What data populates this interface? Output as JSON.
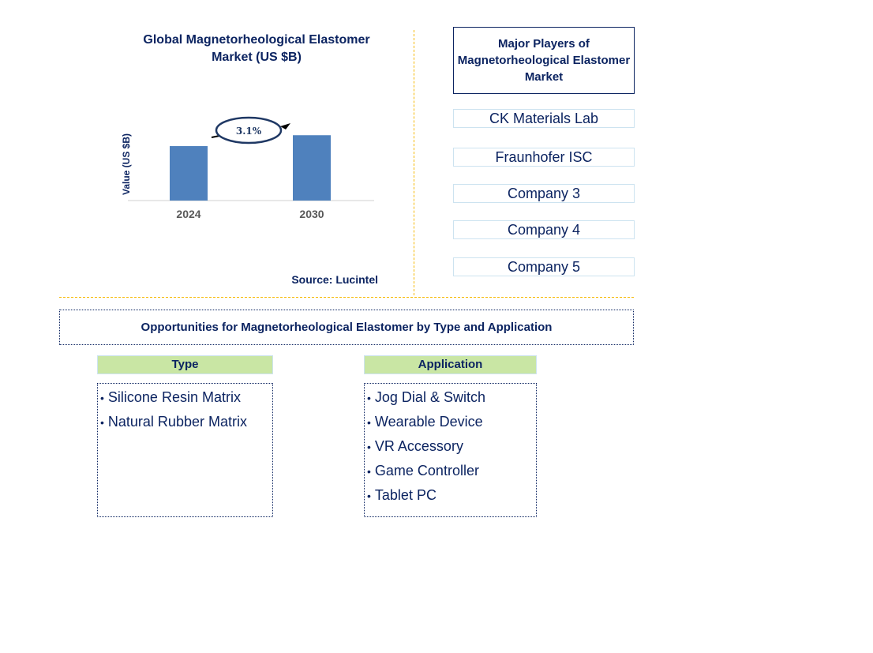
{
  "chart_data": {
    "type": "bar",
    "title": "Global Magnetorheological Elastomer Market (US $B)",
    "categories": [
      "2024",
      "2030"
    ],
    "values": [
      1.0,
      1.2
    ],
    "value_note": "relative bar heights; no y-axis values shown",
    "xlabel": "",
    "ylabel": "Value (US $B)",
    "ylim": [
      0,
      1.45
    ],
    "grid": false,
    "bar_color": "#4f81bd",
    "annotation": {
      "text": "3.1%",
      "meaning": "CAGR 2024-2030",
      "shape": "ellipse-arrow"
    }
  },
  "chart": {
    "title": "Global Magnetorheological Elastomer Market (US $B)",
    "ylabel": "Value (US $B)",
    "cagr_label": "3.1%",
    "source": "Source: Lucintel"
  },
  "players": {
    "title": "Major Players of Magnetorheological Elastomer Market",
    "items": [
      "CK Materials Lab",
      "Fraunhofer ISC",
      "Company 3",
      "Company 4",
      "Company 5"
    ]
  },
  "opportunities": {
    "title": "Opportunities for Magnetorheological Elastomer by Type and Application",
    "type": {
      "header": "Type",
      "items": [
        "Silicone Resin Matrix",
        "Natural Rubber Matrix"
      ]
    },
    "application": {
      "header": "Application",
      "items": [
        "Jog Dial & Switch",
        "Wearable Device",
        "VR Accessory",
        "Game Controller",
        "Tablet PC"
      ]
    }
  },
  "colors": {
    "text_navy": "#0c2461",
    "bar_blue": "#4f81bd",
    "divider_gold": "#f5b800",
    "header_green": "#c9e6a4",
    "player_border": "#cde3f0"
  }
}
